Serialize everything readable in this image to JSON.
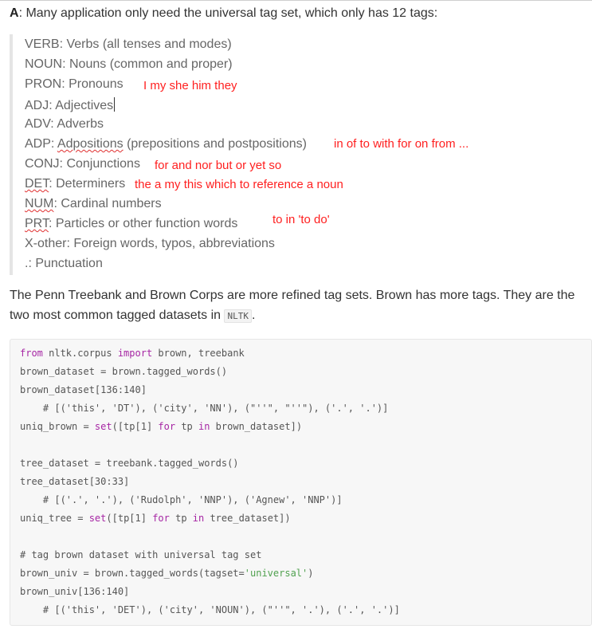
{
  "intro": {
    "label": "A",
    "text": ": Many application only need the universal tag set, which only has 12 tags:"
  },
  "tags": [
    {
      "pre": "",
      "ul": "",
      "post": "VERB: Verbs (all tenses and modes)"
    },
    {
      "pre": "",
      "ul": "",
      "post": "NOUN: Nouns (common and proper)"
    },
    {
      "pre": "",
      "ul": "",
      "post": "PRON: Pronouns"
    },
    {
      "pre": "",
      "ul": "",
      "post": "ADJ: Adjectives"
    },
    {
      "pre": "",
      "ul": "",
      "post": "ADV: Adverbs"
    },
    {
      "pre": "ADP: ",
      "ul": "Adpositions",
      "post": " (prepositions and postpositions)"
    },
    {
      "pre": "",
      "ul": "",
      "post": "CONJ: Conjunctions"
    },
    {
      "pre": "",
      "ul": "DET",
      "post": ": Determiners"
    },
    {
      "pre": "",
      "ul": "NUM",
      "post": ": Cardinal numbers"
    },
    {
      "pre": "",
      "ul": "PRT",
      "post": ": Particles or other function words"
    },
    {
      "pre": "",
      "ul": "",
      "post": "X-other: Foreign words, typos, abbreviations"
    },
    {
      "pre": "",
      "ul": "",
      "post": ".: Punctuation"
    }
  ],
  "notes": {
    "pron": "I my she him they",
    "adp": "in of to with for on from ...",
    "conj": "for and nor but or yet so",
    "det": "the a my this which to reference a noun",
    "prt": "to in 'to do'"
  },
  "paragraph": {
    "text": "The Penn Treebank and Brown Corps are more refined tag sets. Brown has more tags. They are the two most common tagged datasets in ",
    "code": "NLTK",
    "end": "."
  },
  "code": {
    "l1": {
      "kw1": "from",
      "a": " nltk.corpus ",
      "kw2": "import",
      "b": " brown, treebank"
    },
    "l2": {
      "a": "brown_dataset = brown.tagged_words()"
    },
    "l3": {
      "a": "brown_dataset[136:140]"
    },
    "l4": {
      "a": "    # [('this', 'DT'), ('city', 'NN'), (\"''\", \"''\"), ('.', '.')]"
    },
    "l5": {
      "a": "uniq_brown = ",
      "kw1": "set",
      "b": "([tp[1] ",
      "kw2": "for",
      "c": " tp ",
      "kw3": "in",
      "d": " brown_dataset])"
    },
    "l6": {
      "a": "tree_dataset = treebank.tagged_words()"
    },
    "l7": {
      "a": "tree_dataset[30:33]"
    },
    "l8": {
      "a": "    # [('.', '.'), ('Rudolph', 'NNP'), ('Agnew', 'NNP')]"
    },
    "l9": {
      "a": "uniq_tree = ",
      "kw1": "set",
      "b": "([tp[1] ",
      "kw2": "for",
      "c": " tp ",
      "kw3": "in",
      "d": " tree_dataset])"
    },
    "l10": {
      "a": "# tag brown dataset with universal tag set"
    },
    "l11": {
      "a": "brown_univ = brown.tagged_words(tagset=",
      "s": "'universal'",
      "b": ")"
    },
    "l12": {
      "a": "brown_univ[136:140]"
    },
    "l13": {
      "a": "    # [('this', 'DET'), ('city', 'NOUN'), (\"''\", '.'), ('.', '.')]"
    }
  },
  "colors": {
    "annotation": "#ff2020",
    "quote_text": "#666666",
    "code_bg": "#f7f7f7",
    "keyword": "#a626a4"
  }
}
